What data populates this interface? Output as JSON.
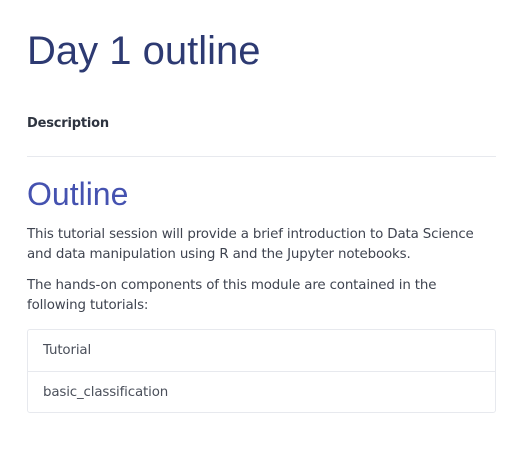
{
  "page": {
    "title": "Day 1 outline",
    "description_label": "Description"
  },
  "outline": {
    "heading": "Outline",
    "paragraphs": [
      "This tutorial session will provide a brief introduction to Data Science and data manipulation using R and the Jupyter notebooks.",
      "The hands-on components of this module are contained in the following tutorials:"
    ]
  },
  "tutorials": {
    "header": "Tutorial",
    "items": [
      "basic_classification"
    ]
  },
  "colors": {
    "title": "#2d3a72",
    "heading": "#4552b0",
    "body_text": "#3f4450",
    "divider": "#e7e9ee"
  }
}
